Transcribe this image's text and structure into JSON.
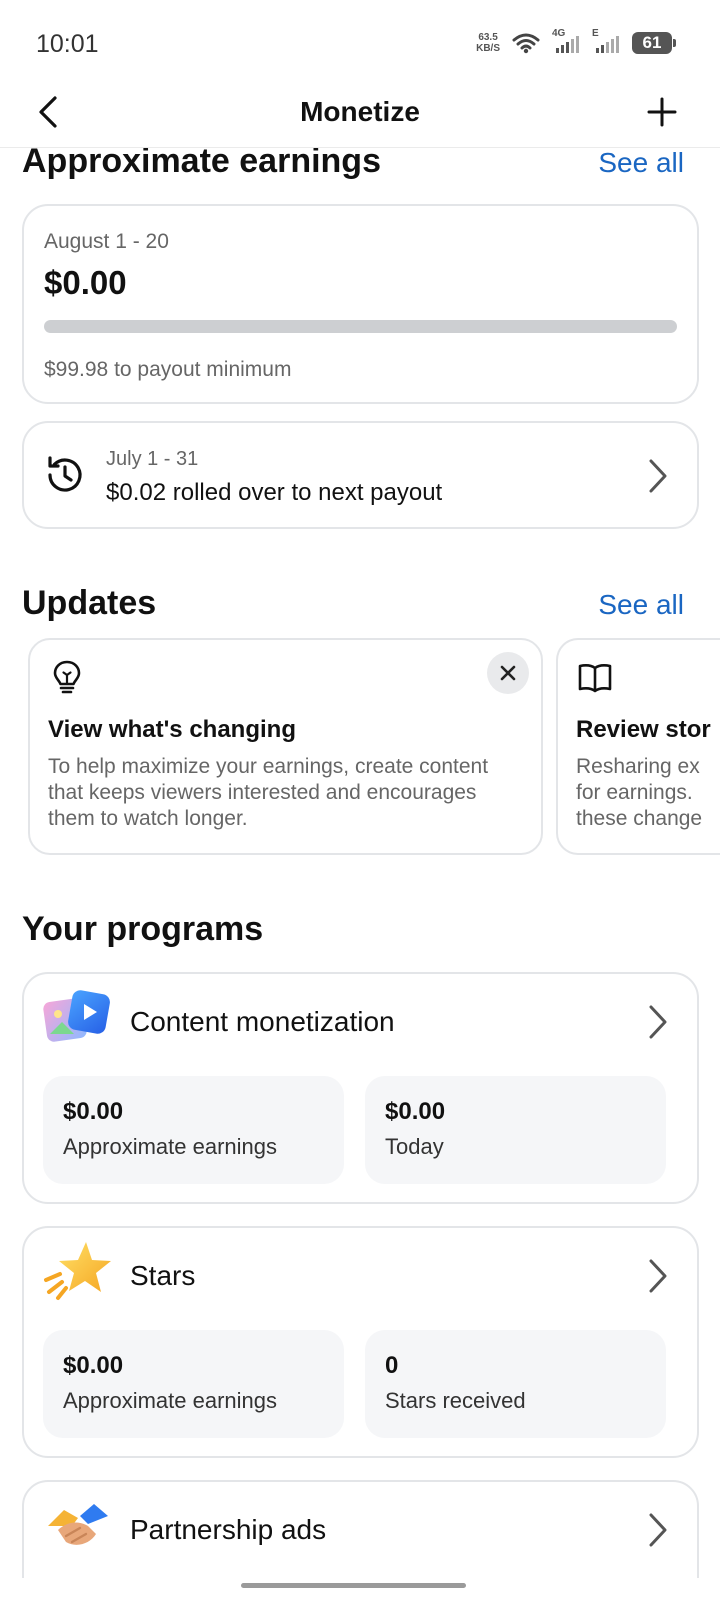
{
  "status": {
    "time": "10:01",
    "net_speed_value": "63.5",
    "net_speed_unit": "KB/S",
    "sim1_tag": "4G",
    "sim2_tag": "E",
    "battery": "61"
  },
  "nav": {
    "title": "Monetize"
  },
  "earnings": {
    "section_title": "Approximate earnings",
    "see_all": "See all",
    "period": "August 1 - 20",
    "amount": "$0.00",
    "progress_percent": 0,
    "note": "$99.98 to payout minimum",
    "rollover_period": "July 1 - 31",
    "rollover_text": "$0.02 rolled over to next payout"
  },
  "updates": {
    "section_title": "Updates",
    "see_all": "See all",
    "cards": [
      {
        "icon": "lightbulb-icon",
        "title": "View what's changing",
        "body": "To help maximize your earnings, create content that keeps viewers interested and encourages them to watch longer."
      },
      {
        "icon": "book-icon",
        "title": "Review stor",
        "body_lines": [
          "Resharing ex",
          "for earnings.",
          "these change"
        ]
      }
    ]
  },
  "programs": {
    "section_title": "Your programs",
    "items": [
      {
        "name": "Content monetization",
        "icon": "content-monetization-icon",
        "stats": [
          {
            "value": "$0.00",
            "label": "Approximate earnings"
          },
          {
            "value": "$0.00",
            "label": "Today"
          }
        ]
      },
      {
        "name": "Stars",
        "icon": "star-icon",
        "stats": [
          {
            "value": "$0.00",
            "label": "Approximate earnings"
          },
          {
            "value": "0",
            "label": "Stars received"
          }
        ]
      },
      {
        "name": "Partnership ads",
        "icon": "handshake-icon"
      }
    ]
  },
  "colors": {
    "accent": "#1a66c2",
    "card_border": "#e3e5e8",
    "stat_bg": "#f5f6f8"
  }
}
